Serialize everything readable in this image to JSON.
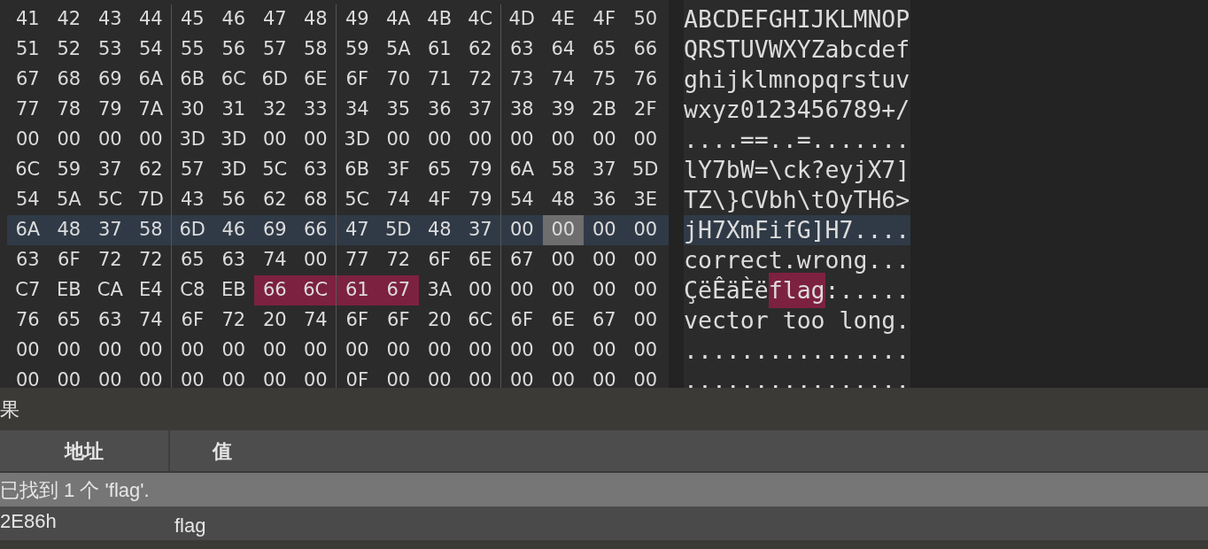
{
  "hex_view": {
    "rows": [
      {
        "selected": false,
        "bytes": [
          {
            "text": "41",
            "kind": "plain"
          },
          {
            "text": "42",
            "kind": "plain"
          },
          {
            "text": "43",
            "kind": "plain"
          },
          {
            "text": "44",
            "kind": "plain"
          },
          {
            "text": "45",
            "kind": "plain"
          },
          {
            "text": "46",
            "kind": "plain"
          },
          {
            "text": "47",
            "kind": "plain"
          },
          {
            "text": "48",
            "kind": "plain"
          },
          {
            "text": "49",
            "kind": "plain"
          },
          {
            "text": "4A",
            "kind": "plain"
          },
          {
            "text": "4B",
            "kind": "plain"
          },
          {
            "text": "4C",
            "kind": "plain"
          },
          {
            "text": "4D",
            "kind": "plain"
          },
          {
            "text": "4E",
            "kind": "plain"
          },
          {
            "text": "4F",
            "kind": "plain"
          },
          {
            "text": "50",
            "kind": "plain"
          }
        ],
        "ascii": [
          {
            "text": "ABCDEFGHIJKLMNOP",
            "kind": "plain"
          }
        ]
      },
      {
        "selected": false,
        "bytes": [
          {
            "text": "51",
            "kind": "plain"
          },
          {
            "text": "52",
            "kind": "plain"
          },
          {
            "text": "53",
            "kind": "plain"
          },
          {
            "text": "54",
            "kind": "plain"
          },
          {
            "text": "55",
            "kind": "plain"
          },
          {
            "text": "56",
            "kind": "plain"
          },
          {
            "text": "57",
            "kind": "plain"
          },
          {
            "text": "58",
            "kind": "plain"
          },
          {
            "text": "59",
            "kind": "plain"
          },
          {
            "text": "5A",
            "kind": "plain"
          },
          {
            "text": "61",
            "kind": "plain"
          },
          {
            "text": "62",
            "kind": "plain"
          },
          {
            "text": "63",
            "kind": "plain"
          },
          {
            "text": "64",
            "kind": "plain"
          },
          {
            "text": "65",
            "kind": "plain"
          },
          {
            "text": "66",
            "kind": "plain"
          }
        ],
        "ascii": [
          {
            "text": "QRSTUVWXYZabcdef",
            "kind": "plain"
          }
        ]
      },
      {
        "selected": false,
        "bytes": [
          {
            "text": "67",
            "kind": "plain"
          },
          {
            "text": "68",
            "kind": "plain"
          },
          {
            "text": "69",
            "kind": "plain"
          },
          {
            "text": "6A",
            "kind": "plain"
          },
          {
            "text": "6B",
            "kind": "plain"
          },
          {
            "text": "6C",
            "kind": "plain"
          },
          {
            "text": "6D",
            "kind": "plain"
          },
          {
            "text": "6E",
            "kind": "plain"
          },
          {
            "text": "6F",
            "kind": "plain"
          },
          {
            "text": "70",
            "kind": "plain"
          },
          {
            "text": "71",
            "kind": "plain"
          },
          {
            "text": "72",
            "kind": "plain"
          },
          {
            "text": "73",
            "kind": "plain"
          },
          {
            "text": "74",
            "kind": "plain"
          },
          {
            "text": "75",
            "kind": "plain"
          },
          {
            "text": "76",
            "kind": "plain"
          }
        ],
        "ascii": [
          {
            "text": "ghijklmnopqrstuv",
            "kind": "plain"
          }
        ]
      },
      {
        "selected": false,
        "bytes": [
          {
            "text": "77",
            "kind": "plain"
          },
          {
            "text": "78",
            "kind": "plain"
          },
          {
            "text": "79",
            "kind": "plain"
          },
          {
            "text": "7A",
            "kind": "plain"
          },
          {
            "text": "30",
            "kind": "plain"
          },
          {
            "text": "31",
            "kind": "plain"
          },
          {
            "text": "32",
            "kind": "plain"
          },
          {
            "text": "33",
            "kind": "plain"
          },
          {
            "text": "34",
            "kind": "plain"
          },
          {
            "text": "35",
            "kind": "plain"
          },
          {
            "text": "36",
            "kind": "plain"
          },
          {
            "text": "37",
            "kind": "plain"
          },
          {
            "text": "38",
            "kind": "plain"
          },
          {
            "text": "39",
            "kind": "plain"
          },
          {
            "text": "2B",
            "kind": "plain"
          },
          {
            "text": "2F",
            "kind": "plain"
          }
        ],
        "ascii": [
          {
            "text": "wxyz0123456789+/",
            "kind": "plain"
          }
        ]
      },
      {
        "selected": false,
        "bytes": [
          {
            "text": "00",
            "kind": "plain"
          },
          {
            "text": "00",
            "kind": "plain"
          },
          {
            "text": "00",
            "kind": "plain"
          },
          {
            "text": "00",
            "kind": "plain"
          },
          {
            "text": "3D",
            "kind": "plain"
          },
          {
            "text": "3D",
            "kind": "plain"
          },
          {
            "text": "00",
            "kind": "plain"
          },
          {
            "text": "00",
            "kind": "plain"
          },
          {
            "text": "3D",
            "kind": "plain"
          },
          {
            "text": "00",
            "kind": "plain"
          },
          {
            "text": "00",
            "kind": "plain"
          },
          {
            "text": "00",
            "kind": "plain"
          },
          {
            "text": "00",
            "kind": "plain"
          },
          {
            "text": "00",
            "kind": "plain"
          },
          {
            "text": "00",
            "kind": "plain"
          },
          {
            "text": "00",
            "kind": "plain"
          }
        ],
        "ascii": [
          {
            "text": "....==..=.......",
            "kind": "plain"
          }
        ]
      },
      {
        "selected": false,
        "bytes": [
          {
            "text": "6C",
            "kind": "plain"
          },
          {
            "text": "59",
            "kind": "plain"
          },
          {
            "text": "37",
            "kind": "plain"
          },
          {
            "text": "62",
            "kind": "plain"
          },
          {
            "text": "57",
            "kind": "plain"
          },
          {
            "text": "3D",
            "kind": "plain"
          },
          {
            "text": "5C",
            "kind": "plain"
          },
          {
            "text": "63",
            "kind": "plain"
          },
          {
            "text": "6B",
            "kind": "plain"
          },
          {
            "text": "3F",
            "kind": "plain"
          },
          {
            "text": "65",
            "kind": "plain"
          },
          {
            "text": "79",
            "kind": "plain"
          },
          {
            "text": "6A",
            "kind": "plain"
          },
          {
            "text": "58",
            "kind": "plain"
          },
          {
            "text": "37",
            "kind": "plain"
          },
          {
            "text": "5D",
            "kind": "plain"
          }
        ],
        "ascii": [
          {
            "text": "lY7bW=\\ck?eyjX7]",
            "kind": "plain"
          }
        ]
      },
      {
        "selected": false,
        "bytes": [
          {
            "text": "54",
            "kind": "plain"
          },
          {
            "text": "5A",
            "kind": "plain"
          },
          {
            "text": "5C",
            "kind": "plain"
          },
          {
            "text": "7D",
            "kind": "plain"
          },
          {
            "text": "43",
            "kind": "plain"
          },
          {
            "text": "56",
            "kind": "plain"
          },
          {
            "text": "62",
            "kind": "plain"
          },
          {
            "text": "68",
            "kind": "plain"
          },
          {
            "text": "5C",
            "kind": "plain"
          },
          {
            "text": "74",
            "kind": "plain"
          },
          {
            "text": "4F",
            "kind": "plain"
          },
          {
            "text": "79",
            "kind": "plain"
          },
          {
            "text": "54",
            "kind": "plain"
          },
          {
            "text": "48",
            "kind": "plain"
          },
          {
            "text": "36",
            "kind": "plain"
          },
          {
            "text": "3E",
            "kind": "plain"
          }
        ],
        "ascii": [
          {
            "text": "TZ\\}CVbh\\tOyTH6>",
            "kind": "plain"
          }
        ]
      },
      {
        "selected": true,
        "bytes": [
          {
            "text": "6A",
            "kind": "plain"
          },
          {
            "text": "48",
            "kind": "plain"
          },
          {
            "text": "37",
            "kind": "plain"
          },
          {
            "text": "58",
            "kind": "plain"
          },
          {
            "text": "6D",
            "kind": "plain"
          },
          {
            "text": "46",
            "kind": "plain"
          },
          {
            "text": "69",
            "kind": "plain"
          },
          {
            "text": "66",
            "kind": "plain"
          },
          {
            "text": "47",
            "kind": "plain"
          },
          {
            "text": "5D",
            "kind": "plain"
          },
          {
            "text": "48",
            "kind": "plain"
          },
          {
            "text": "37",
            "kind": "plain"
          },
          {
            "text": "00",
            "kind": "plain"
          },
          {
            "text": "00",
            "kind": "cursor"
          },
          {
            "text": "00",
            "kind": "plain"
          },
          {
            "text": "00",
            "kind": "plain"
          }
        ],
        "ascii": [
          {
            "text": "jH7XmFifG]H7....",
            "kind": "plain"
          }
        ]
      },
      {
        "selected": false,
        "bytes": [
          {
            "text": "63",
            "kind": "plain"
          },
          {
            "text": "6F",
            "kind": "plain"
          },
          {
            "text": "72",
            "kind": "plain"
          },
          {
            "text": "72",
            "kind": "plain"
          },
          {
            "text": "65",
            "kind": "plain"
          },
          {
            "text": "63",
            "kind": "plain"
          },
          {
            "text": "74",
            "kind": "plain"
          },
          {
            "text": "00",
            "kind": "plain"
          },
          {
            "text": "77",
            "kind": "plain"
          },
          {
            "text": "72",
            "kind": "plain"
          },
          {
            "text": "6F",
            "kind": "plain"
          },
          {
            "text": "6E",
            "kind": "plain"
          },
          {
            "text": "67",
            "kind": "plain"
          },
          {
            "text": "00",
            "kind": "plain"
          },
          {
            "text": "00",
            "kind": "plain"
          },
          {
            "text": "00",
            "kind": "plain"
          }
        ],
        "ascii": [
          {
            "text": "correct.wrong...",
            "kind": "plain"
          }
        ]
      },
      {
        "selected": false,
        "bytes": [
          {
            "text": "C7",
            "kind": "plain"
          },
          {
            "text": "EB",
            "kind": "plain"
          },
          {
            "text": "CA",
            "kind": "plain"
          },
          {
            "text": "E4",
            "kind": "plain"
          },
          {
            "text": "C8",
            "kind": "plain"
          },
          {
            "text": "EB",
            "kind": "plain"
          },
          {
            "text": "66",
            "kind": "match"
          },
          {
            "text": "6C",
            "kind": "match"
          },
          {
            "text": "61",
            "kind": "match"
          },
          {
            "text": "67",
            "kind": "match"
          },
          {
            "text": "3A",
            "kind": "plain"
          },
          {
            "text": "00",
            "kind": "plain"
          },
          {
            "text": "00",
            "kind": "plain"
          },
          {
            "text": "00",
            "kind": "plain"
          },
          {
            "text": "00",
            "kind": "plain"
          },
          {
            "text": "00",
            "kind": "plain"
          }
        ],
        "ascii": [
          {
            "text": "ÇëÊäÈë",
            "kind": "plain"
          },
          {
            "text": "flag",
            "kind": "match"
          },
          {
            "text": ":.....",
            "kind": "plain"
          }
        ]
      },
      {
        "selected": false,
        "bytes": [
          {
            "text": "76",
            "kind": "plain"
          },
          {
            "text": "65",
            "kind": "plain"
          },
          {
            "text": "63",
            "kind": "plain"
          },
          {
            "text": "74",
            "kind": "plain"
          },
          {
            "text": "6F",
            "kind": "plain"
          },
          {
            "text": "72",
            "kind": "plain"
          },
          {
            "text": "20",
            "kind": "plain"
          },
          {
            "text": "74",
            "kind": "plain"
          },
          {
            "text": "6F",
            "kind": "plain"
          },
          {
            "text": "6F",
            "kind": "plain"
          },
          {
            "text": "20",
            "kind": "plain"
          },
          {
            "text": "6C",
            "kind": "plain"
          },
          {
            "text": "6F",
            "kind": "plain"
          },
          {
            "text": "6E",
            "kind": "plain"
          },
          {
            "text": "67",
            "kind": "plain"
          },
          {
            "text": "00",
            "kind": "plain"
          }
        ],
        "ascii": [
          {
            "text": "vector too long.",
            "kind": "plain"
          }
        ]
      },
      {
        "selected": false,
        "bytes": [
          {
            "text": "00",
            "kind": "plain"
          },
          {
            "text": "00",
            "kind": "plain"
          },
          {
            "text": "00",
            "kind": "plain"
          },
          {
            "text": "00",
            "kind": "plain"
          },
          {
            "text": "00",
            "kind": "plain"
          },
          {
            "text": "00",
            "kind": "plain"
          },
          {
            "text": "00",
            "kind": "plain"
          },
          {
            "text": "00",
            "kind": "plain"
          },
          {
            "text": "00",
            "kind": "plain"
          },
          {
            "text": "00",
            "kind": "plain"
          },
          {
            "text": "00",
            "kind": "plain"
          },
          {
            "text": "00",
            "kind": "plain"
          },
          {
            "text": "00",
            "kind": "plain"
          },
          {
            "text": "00",
            "kind": "plain"
          },
          {
            "text": "00",
            "kind": "plain"
          },
          {
            "text": "00",
            "kind": "plain"
          }
        ],
        "ascii": [
          {
            "text": "................",
            "kind": "plain"
          }
        ]
      },
      {
        "selected": false,
        "bytes": [
          {
            "text": "00",
            "kind": "plain"
          },
          {
            "text": "00",
            "kind": "plain"
          },
          {
            "text": "00",
            "kind": "plain"
          },
          {
            "text": "00",
            "kind": "plain"
          },
          {
            "text": "00",
            "kind": "plain"
          },
          {
            "text": "00",
            "kind": "plain"
          },
          {
            "text": "00",
            "kind": "plain"
          },
          {
            "text": "00",
            "kind": "plain"
          },
          {
            "text": "0F",
            "kind": "plain"
          },
          {
            "text": "00",
            "kind": "plain"
          },
          {
            "text": "00",
            "kind": "plain"
          },
          {
            "text": "00",
            "kind": "plain"
          },
          {
            "text": "00",
            "kind": "plain"
          },
          {
            "text": "00",
            "kind": "plain"
          },
          {
            "text": "00",
            "kind": "plain"
          },
          {
            "text": "00",
            "kind": "plain"
          }
        ],
        "ascii": [
          {
            "text": "................",
            "kind": "plain"
          }
        ]
      }
    ]
  },
  "results_panel": {
    "title": "果",
    "columns": [
      "地址",
      "值"
    ],
    "rows": [
      {
        "kind": "summary",
        "selected": true,
        "text": "已找到 1 个 'flag'."
      },
      {
        "kind": "result",
        "selected": false,
        "address": "2E86h",
        "value": "flag"
      }
    ]
  }
}
